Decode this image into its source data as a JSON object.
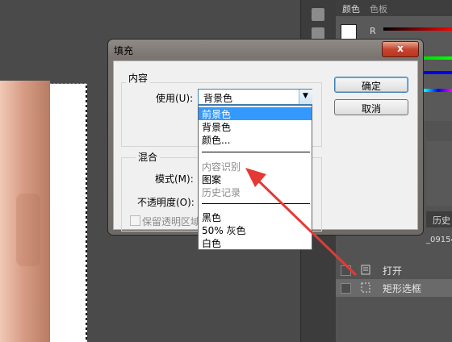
{
  "right_panel": {
    "tab_color": "颜色",
    "tab_swatches": "色板",
    "r_label": "R",
    "history_tab": "历史",
    "history_snapshot": "_09154",
    "history_items": [
      {
        "label": "打开",
        "icon": "document-icon"
      },
      {
        "label": "矩形选框",
        "icon": "rect-marquee-icon"
      }
    ]
  },
  "dialog": {
    "title": "填充",
    "close_label": "x",
    "ok_label": "确定",
    "cancel_label": "取消",
    "content_group": {
      "title": "内容",
      "use_label": "使用(U):",
      "use_value": "背景色"
    },
    "blend_group": {
      "title": "混合",
      "mode_label": "模式(M):",
      "opacity_label": "不透明度(O):",
      "preserve_label": "保留透明区域",
      "preserve_checked": false
    }
  },
  "dropdown": {
    "options": [
      {
        "label": "前景色",
        "selected": true,
        "enabled": true
      },
      {
        "label": "背景色",
        "selected": false,
        "enabled": true
      },
      {
        "label": "颜色...",
        "selected": false,
        "enabled": true
      },
      {
        "label": "内容识别",
        "selected": false,
        "enabled": false
      },
      {
        "label": "图案",
        "selected": false,
        "enabled": true
      },
      {
        "label": "历史记录",
        "selected": false,
        "enabled": false
      },
      {
        "label": "黑色",
        "selected": false,
        "enabled": true
      },
      {
        "label": "50% 灰色",
        "selected": false,
        "enabled": true
      },
      {
        "label": "白色",
        "selected": false,
        "enabled": true
      }
    ]
  },
  "annotation_color": "#e53935"
}
